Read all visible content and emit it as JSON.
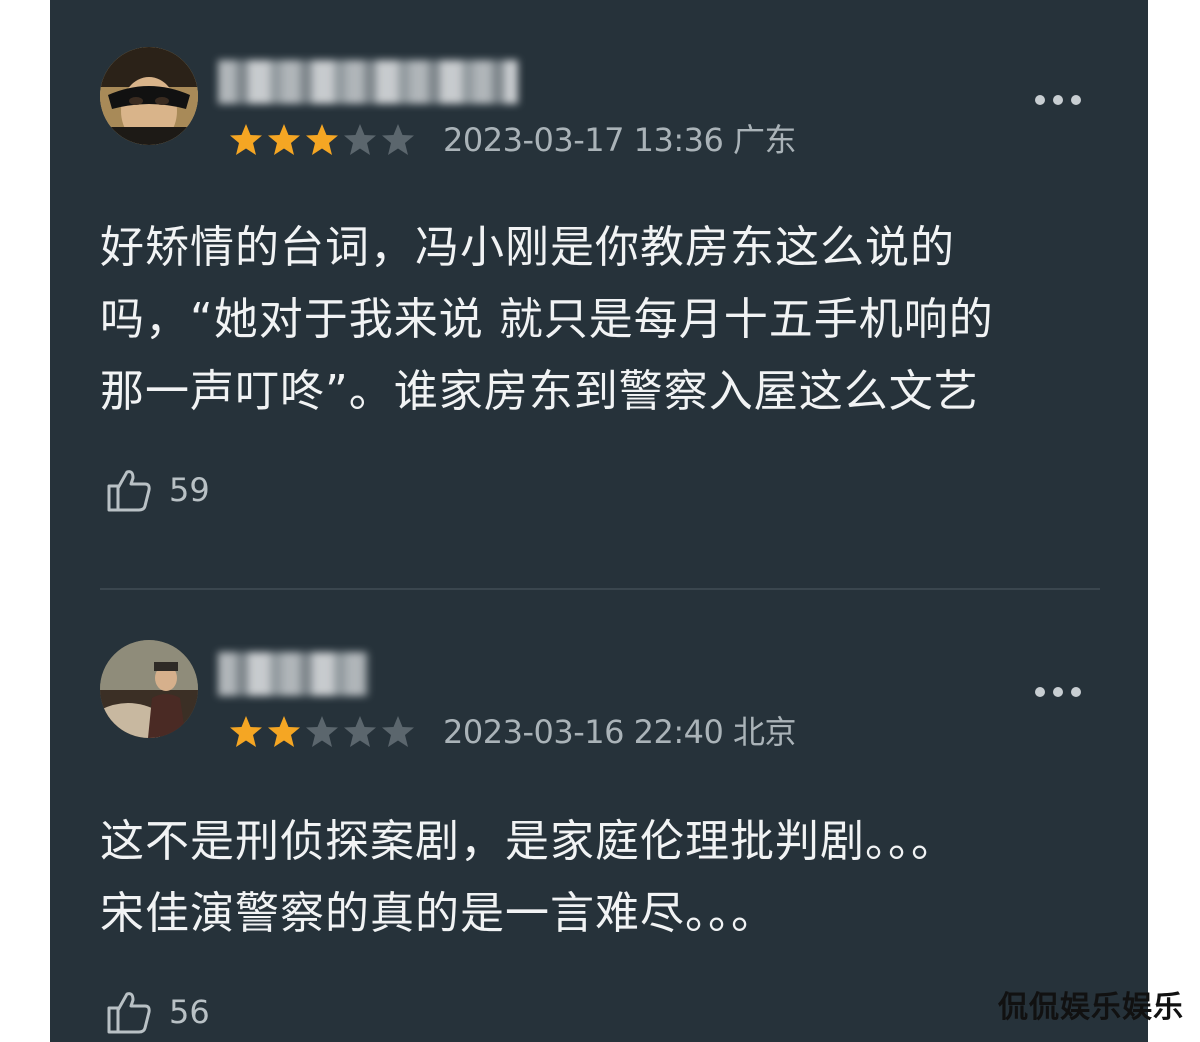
{
  "comments": [
    {
      "rating": 3,
      "max_rating": 5,
      "timestamp": "2023-03-17 13:36",
      "location": "广东",
      "text": "好矫情的台词，冯小刚是你教房东这么说的\n吗，“她对于我来说 就只是每月十五手机响的\n那一声叮咚”。谁家房东到警察入屋这么文艺",
      "likes": "59",
      "avatar_icon": "masked-person-avatar"
    },
    {
      "rating": 2,
      "max_rating": 5,
      "timestamp": "2023-03-16 22:40",
      "location": "北京",
      "text": "这不是刑侦探案剧，是家庭伦理批判剧。。。\n宋佳演警察的真的是一言难尽。。。",
      "likes": "56",
      "avatar_icon": "movie-still-avatar"
    }
  ],
  "colors": {
    "background": "#26323a",
    "star_on": "#f5a623",
    "star_off": "#5b666d",
    "text": "#f1f3f4",
    "meta": "#aab3b8"
  },
  "icons": {
    "like": "thumbs-up-icon",
    "more": "more-dots-icon"
  },
  "watermark": "侃侃娱乐娱乐"
}
